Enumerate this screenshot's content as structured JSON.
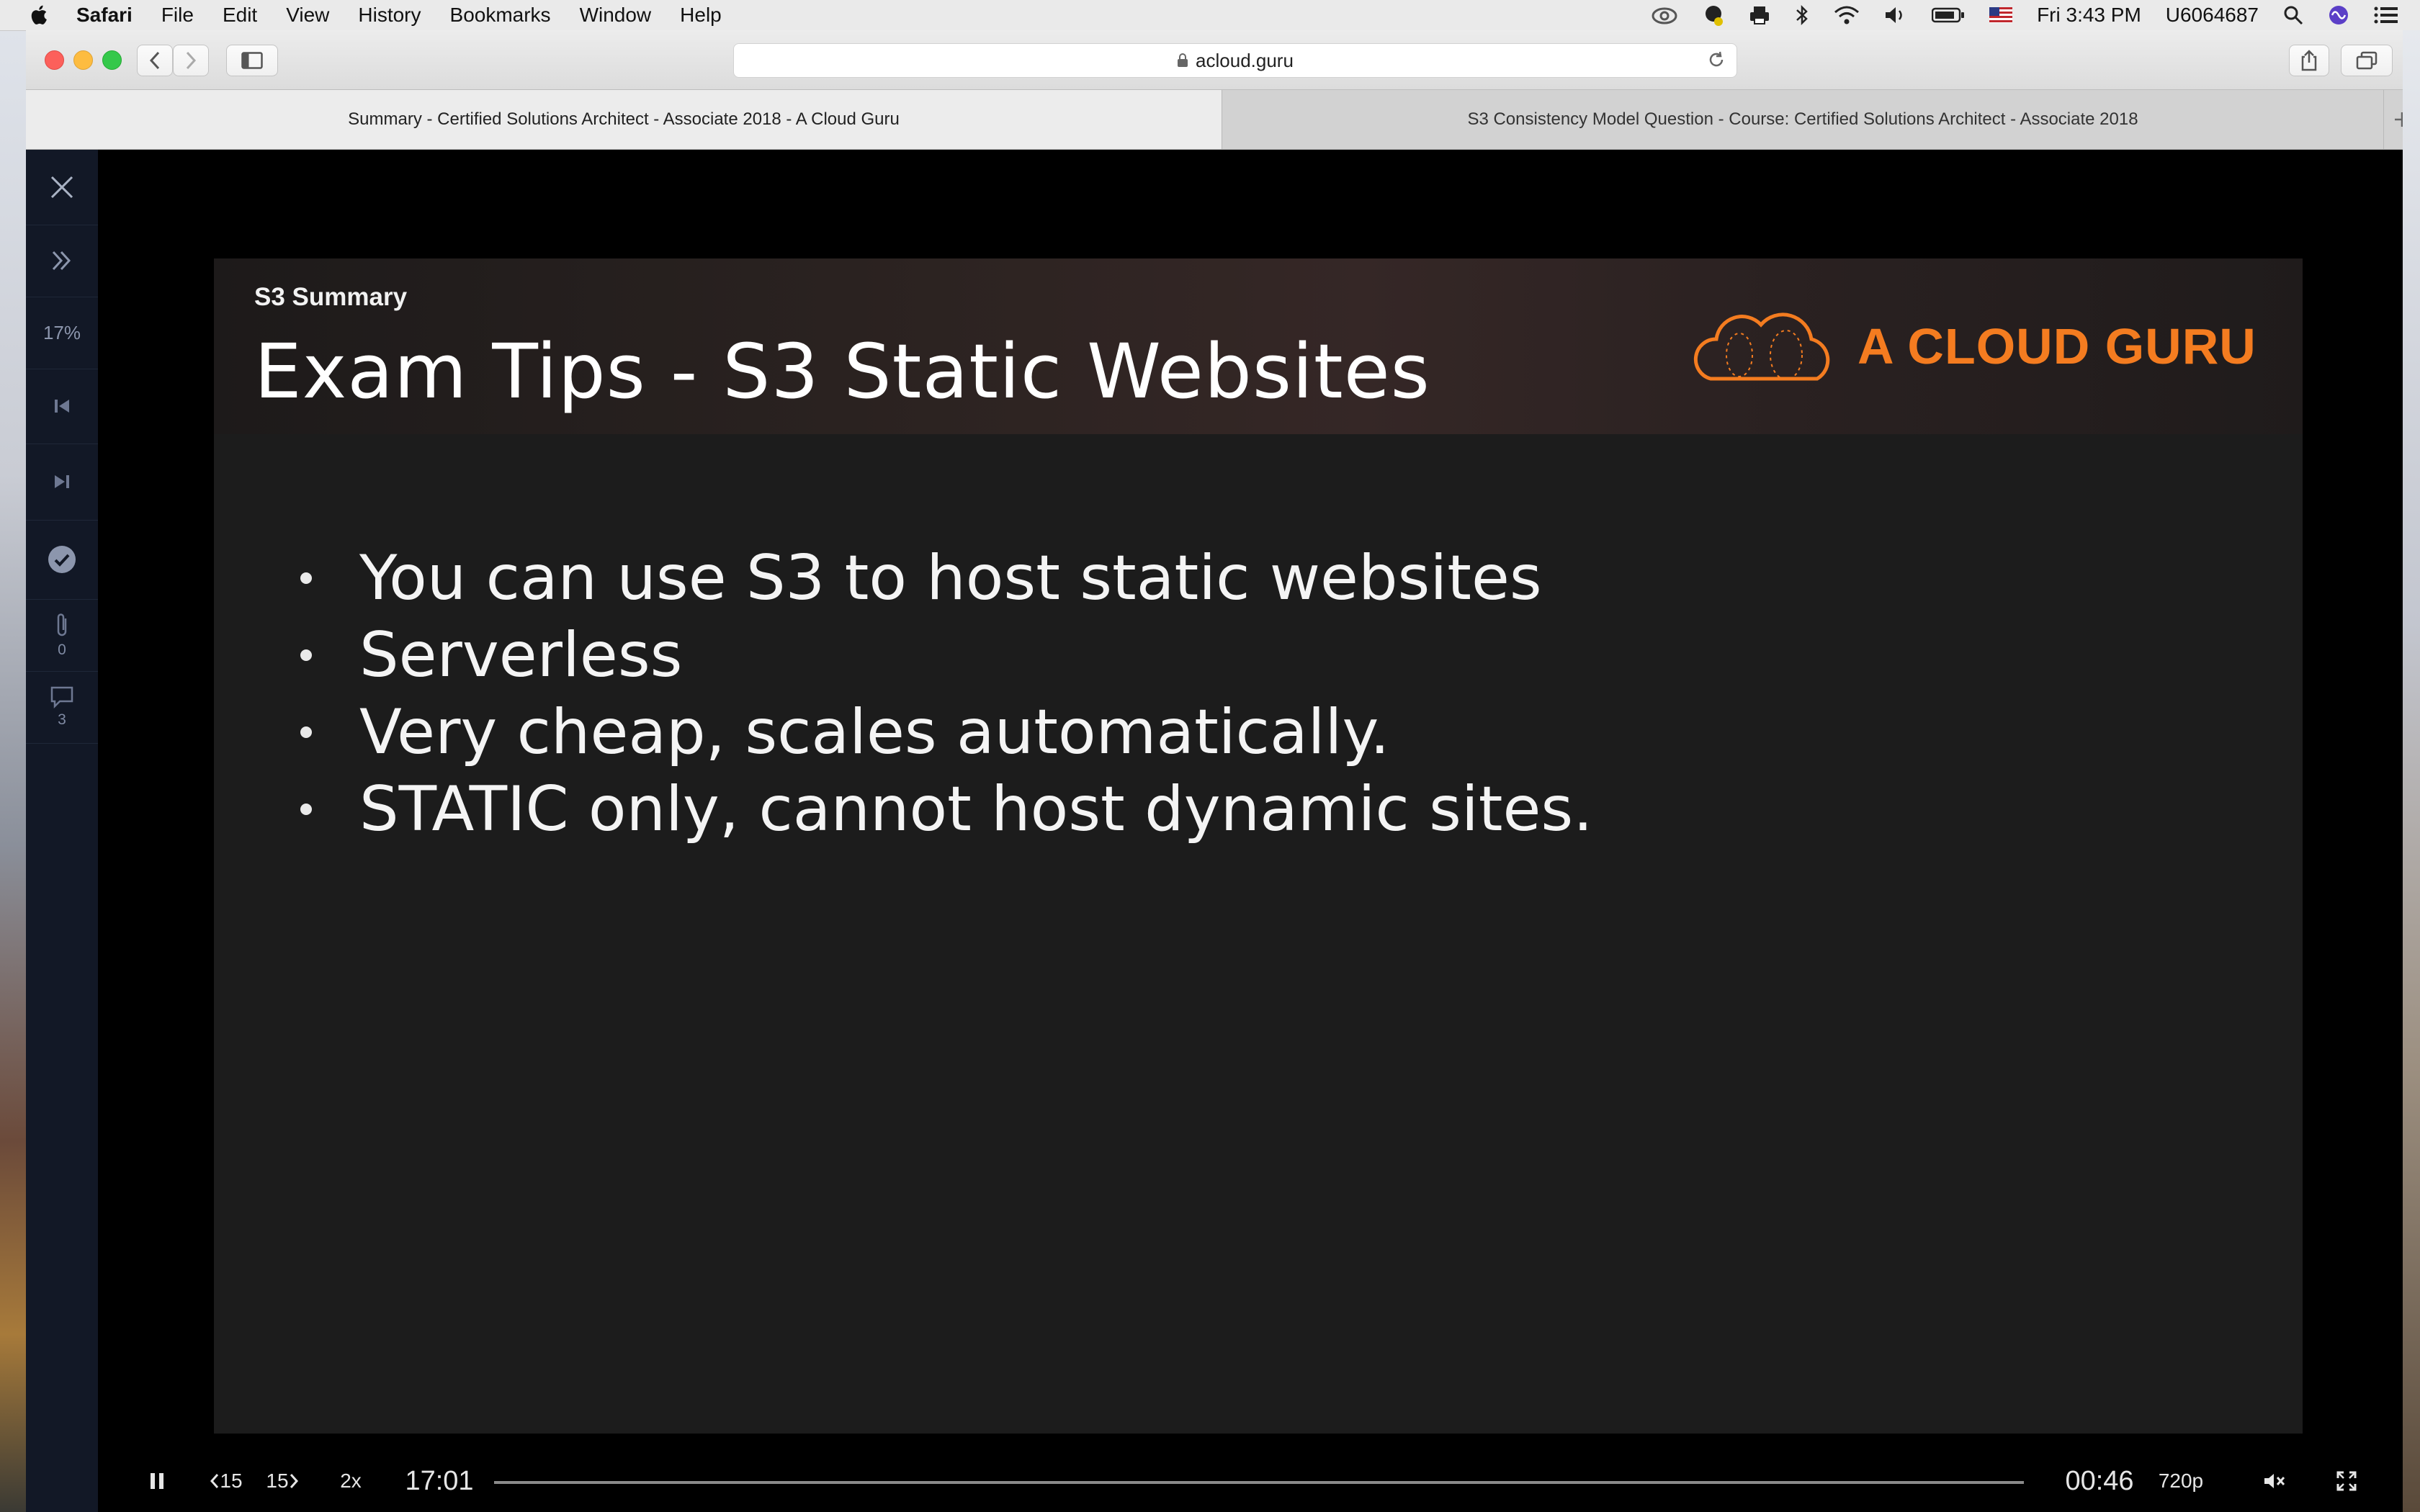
{
  "menubar": {
    "app": "Safari",
    "items": [
      "File",
      "Edit",
      "View",
      "History",
      "Bookmarks",
      "Window",
      "Help"
    ],
    "clock": "Fri 3:43 PM",
    "user": "U6064687",
    "status_icons": [
      "creative-cloud-icon",
      "notification-icon",
      "printer-icon",
      "bluetooth-icon",
      "wifi-icon",
      "volume-icon",
      "battery-icon",
      "us-flag-icon"
    ]
  },
  "browser": {
    "url": "acloud.guru",
    "tabs": [
      {
        "label": "Summary - Certified Solutions Architect - Associate 2018 - A Cloud Guru",
        "active": true
      },
      {
        "label": "S3 Consistency Model Question - Course: Certified Solutions Architect - Associate 2018",
        "active": false
      }
    ]
  },
  "sidebar": {
    "progress": "17%",
    "attachments_count": "0",
    "comments_count": "3"
  },
  "slide": {
    "subtitle": "S3 Summary",
    "title": "Exam Tips - S3 Static Websites",
    "logo_text": "A CLOUD GURU",
    "bullets": [
      "You can use S3 to host static websites",
      "Serverless",
      "Very cheap, scales automatically.",
      "STATIC only, cannot host dynamic sites."
    ]
  },
  "player": {
    "rewind_label": "15",
    "forward_label": "15",
    "speed": "2x",
    "elapsed": "17:01",
    "remaining": "00:46",
    "quality": "720p",
    "progress_fraction": 0.96
  },
  "colors": {
    "accent": "#f47c20",
    "sidebar_bg": "#121826",
    "slide_bg": "#1c1c1c"
  }
}
